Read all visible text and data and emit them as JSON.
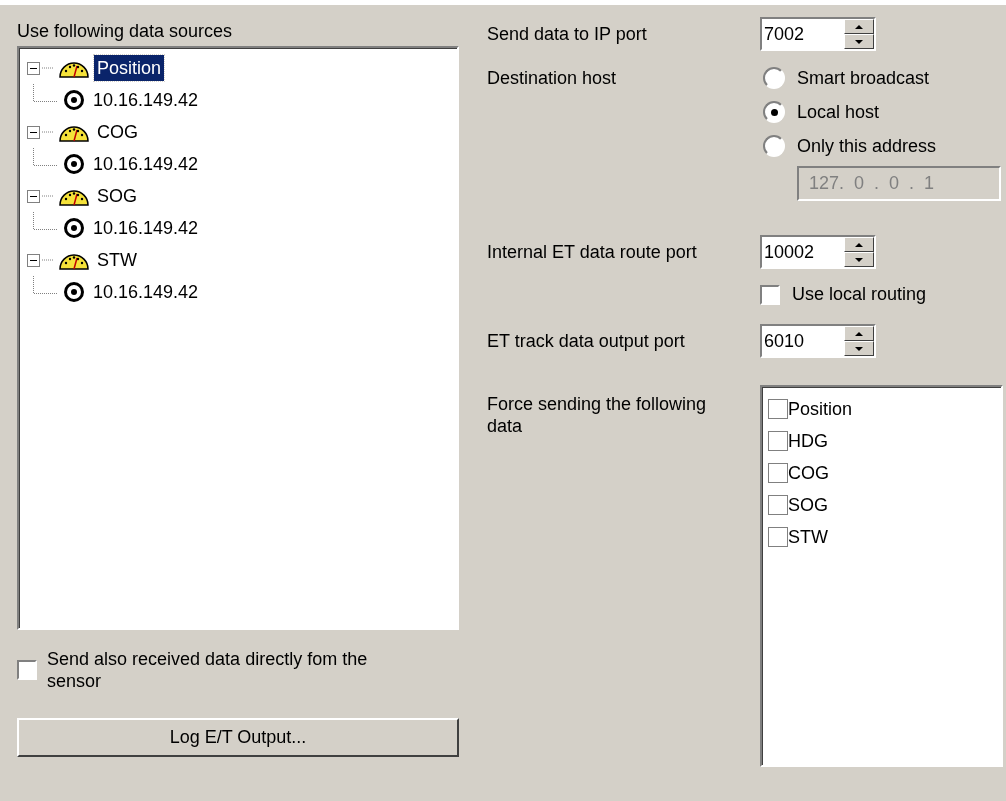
{
  "sources": {
    "label": "Use following data sources",
    "tree": [
      {
        "label": "Position",
        "selected": true,
        "expanded": true,
        "children": [
          {
            "label": "10.16.149.42"
          }
        ]
      },
      {
        "label": "COG",
        "selected": false,
        "expanded": true,
        "children": [
          {
            "label": "10.16.149.42"
          }
        ]
      },
      {
        "label": "SOG",
        "selected": false,
        "expanded": true,
        "children": [
          {
            "label": "10.16.149.42"
          }
        ]
      },
      {
        "label": "STW",
        "selected": false,
        "expanded": true,
        "children": [
          {
            "label": "10.16.149.42"
          }
        ]
      }
    ]
  },
  "send_direct": {
    "label": "Send also received data directly fom the sensor",
    "checked": false
  },
  "log_button": "Log E/T Output...",
  "ip_port": {
    "label": "Send data to IP port",
    "value": "7002"
  },
  "destination": {
    "label": "Destination host",
    "options": [
      {
        "label": "Smart broadcast",
        "selected": false
      },
      {
        "label": "Local host",
        "selected": true
      },
      {
        "label": "Only this address",
        "selected": false
      }
    ],
    "address": {
      "value": "127.  0  .  0  .  1",
      "disabled": true
    }
  },
  "route_port": {
    "label": "Internal ET data route port",
    "value": "10002"
  },
  "local_routing": {
    "label": "Use local routing",
    "checked": false
  },
  "track_port": {
    "label": "ET track data output port",
    "value": "6010"
  },
  "force": {
    "label": "Force sending the following data",
    "items": [
      {
        "label": "Position",
        "checked": false
      },
      {
        "label": "HDG",
        "checked": false
      },
      {
        "label": "COG",
        "checked": false
      },
      {
        "label": "SOG",
        "checked": false
      },
      {
        "label": "STW",
        "checked": false
      }
    ]
  }
}
